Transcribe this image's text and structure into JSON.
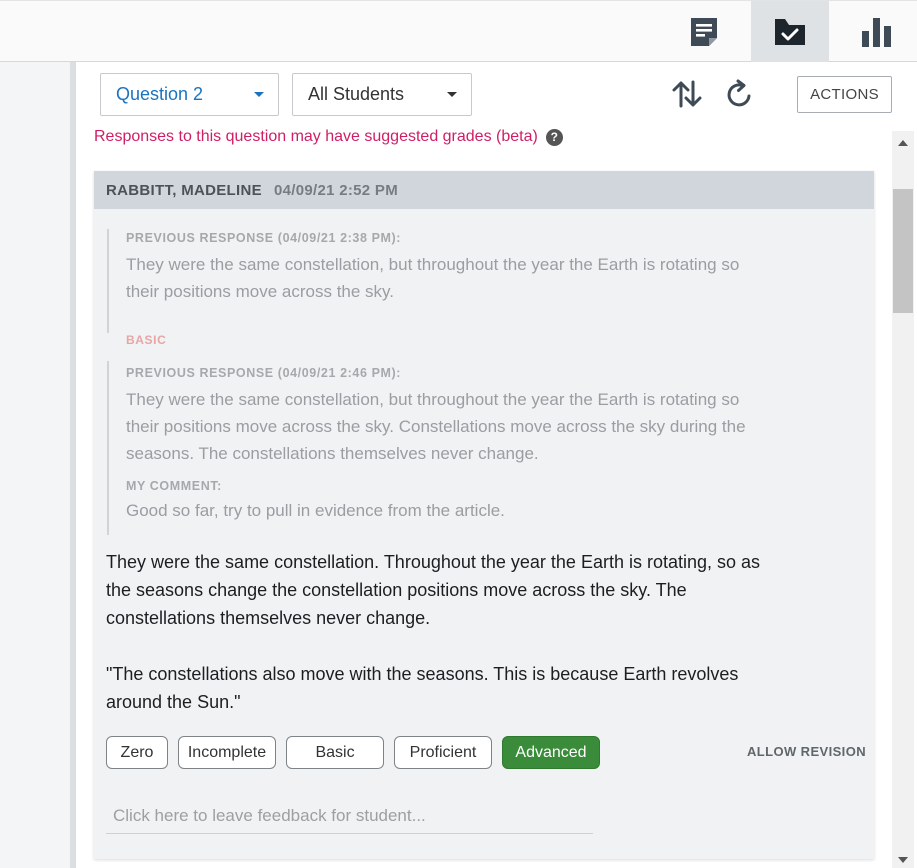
{
  "toolbar": {
    "tabs": [
      {
        "icon": "responses-note-icon",
        "active": false
      },
      {
        "icon": "grading-folder-check-icon",
        "active": true
      },
      {
        "icon": "bar-chart-icon",
        "active": false
      }
    ]
  },
  "filters": {
    "question": "Question 2",
    "students": "All Students"
  },
  "actions_label": "ACTIONS",
  "beta_note": "Responses to this question may have suggested grades (beta)",
  "help_glyph": "?",
  "response": {
    "student_name": "RABBITT, MADELINE",
    "timestamp": "04/09/21 2:52 PM",
    "previous": [
      {
        "label": "PREVIOUS RESPONSE (04/09/21 2:38 PM):",
        "text": "They were the same constellation, but throughout the year the Earth is rotating so their positions move across the sky.",
        "grade_tag": "BASIC"
      },
      {
        "label": "PREVIOUS RESPONSE (04/09/21 2:46 PM):",
        "text": "They were the same constellation, but throughout the year the Earth is rotating so their positions move across the sky. Constellations move across the sky during the seasons. The constellations themselves never change.",
        "comment_label": "MY COMMENT:",
        "comment": "Good so far, try to pull in evidence from the article."
      }
    ],
    "current_paragraphs": [
      "They were the same constellation. Throughout the year the Earth is rotating, so as the seasons change the constellation positions move across the sky. The constellations themselves never change.",
      "\"The constellations also move with the seasons. This is because Earth revolves around the Sun.\""
    ],
    "grades": [
      "Zero",
      "Incomplete",
      "Basic",
      "Proficient",
      "Advanced"
    ],
    "selected_grade": "Advanced",
    "allow_revision": "ALLOW REVISION",
    "feedback_placeholder": "Click here to leave feedback for student..."
  },
  "colors": {
    "accent_blue": "#1a73c0",
    "beta_pink": "#d01e66",
    "selected_green": "#3b8c3a",
    "icon_dark": "#3e4a55"
  }
}
